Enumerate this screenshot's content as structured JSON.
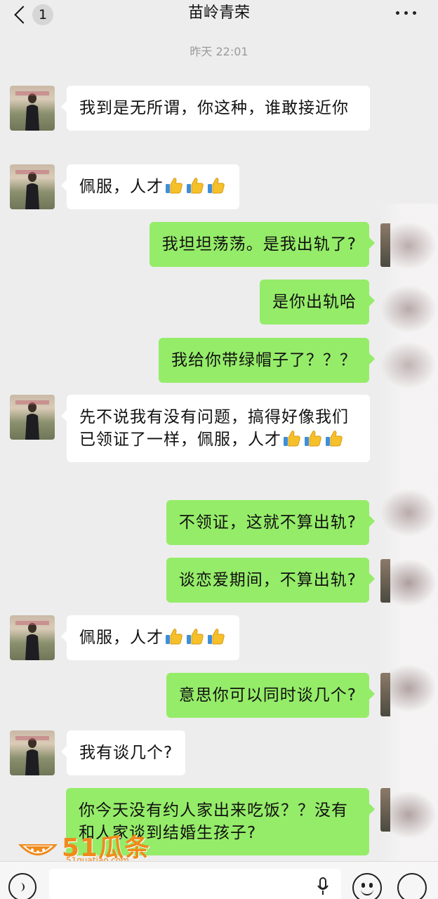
{
  "header": {
    "back_badge": "1",
    "title": "苗岭青荣",
    "more_icon": "more-dots-icon"
  },
  "timestamp": "昨天 22:01",
  "messages": [
    {
      "side": "in",
      "text": "我到是无所谓，你这种，谁敢接近你",
      "thumbs": 0
    },
    {
      "side": "in",
      "text": "佩服，人才",
      "thumbs": 3
    },
    {
      "side": "out",
      "text": "我坦坦荡荡。是我出轨了?",
      "thumbs": 0
    },
    {
      "side": "out",
      "text": "是你出轨哈",
      "thumbs": 0
    },
    {
      "side": "out",
      "text": "我给你带绿帽子了？？？",
      "thumbs": 0
    },
    {
      "side": "in",
      "text": "先不说我有没有问题，搞得好像我们已领证了一样，佩服，人才",
      "thumbs": 3
    },
    {
      "side": "out",
      "text": "不领证，这就不算出轨?",
      "thumbs": 0
    },
    {
      "side": "out",
      "text": "谈恋爱期间，不算出轨?",
      "thumbs": 0
    },
    {
      "side": "in",
      "text": "佩服，人才",
      "thumbs": 3
    },
    {
      "side": "out",
      "text": "意思你可以同时谈几个?",
      "thumbs": 0
    },
    {
      "side": "in",
      "text": "我有谈几个?",
      "thumbs": 0
    },
    {
      "side": "out",
      "text": "你今天没有约人家出来吃饭？？没有和人家谈到结婚生孩子?",
      "thumbs": 0
    }
  ],
  "watermark": {
    "brand": "51瓜条",
    "url": "51guatiao.com"
  },
  "colors": {
    "background": "#ededed",
    "outgoing_bubble": "#95ec69",
    "incoming_bubble": "#ffffff",
    "watermark": "#f08a1c"
  },
  "bottom_bar": {
    "voice_icon": "voice-icon",
    "mic_icon": "mic-icon",
    "emoji_icon": "emoji-icon",
    "plus_icon": "plus-icon"
  }
}
